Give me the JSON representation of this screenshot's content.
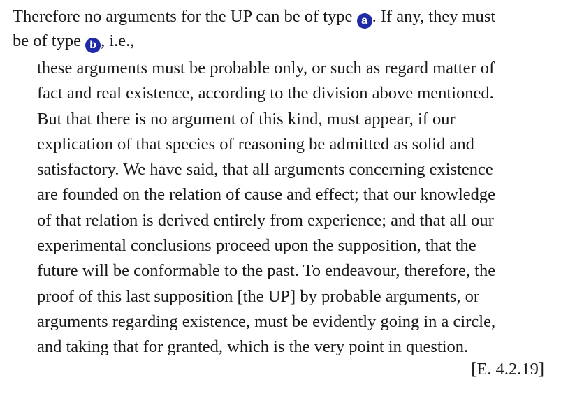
{
  "intro": {
    "line1_before": "Therefore no arguments for the UP can be of type ",
    "badge_a": "a",
    "line1_after": ". If any, they must",
    "line2_before": "be of type ",
    "badge_b": "b",
    "line2_after": ", i.e.,"
  },
  "quote": {
    "lines": [
      "these arguments must be probable only, or such as regard matter of",
      "fact and real existence, according to the division above mentioned.",
      "But that there is no argument of this kind, must appear, if our",
      "explication of that species of reasoning be admitted as solid and",
      "satisfactory. We have said, that all arguments concerning existence",
      "are founded on the relation of cause and effect; that our knowledge",
      "of that relation is derived entirely from experience; and that all our",
      "experimental conclusions proceed upon the supposition, that the",
      "future will be conformable to the past. To endeavour, therefore, the",
      "proof of this last supposition [the UP] by probable arguments, or",
      "arguments regarding existence, must be evidently going in a circle,",
      "and taking that for granted, which is the very point in question."
    ],
    "citation": "[E. 4.2.19]"
  },
  "colors": {
    "badge_background": "#1f2aa6",
    "text": "#1a1a1a",
    "background": "#ffffff"
  }
}
